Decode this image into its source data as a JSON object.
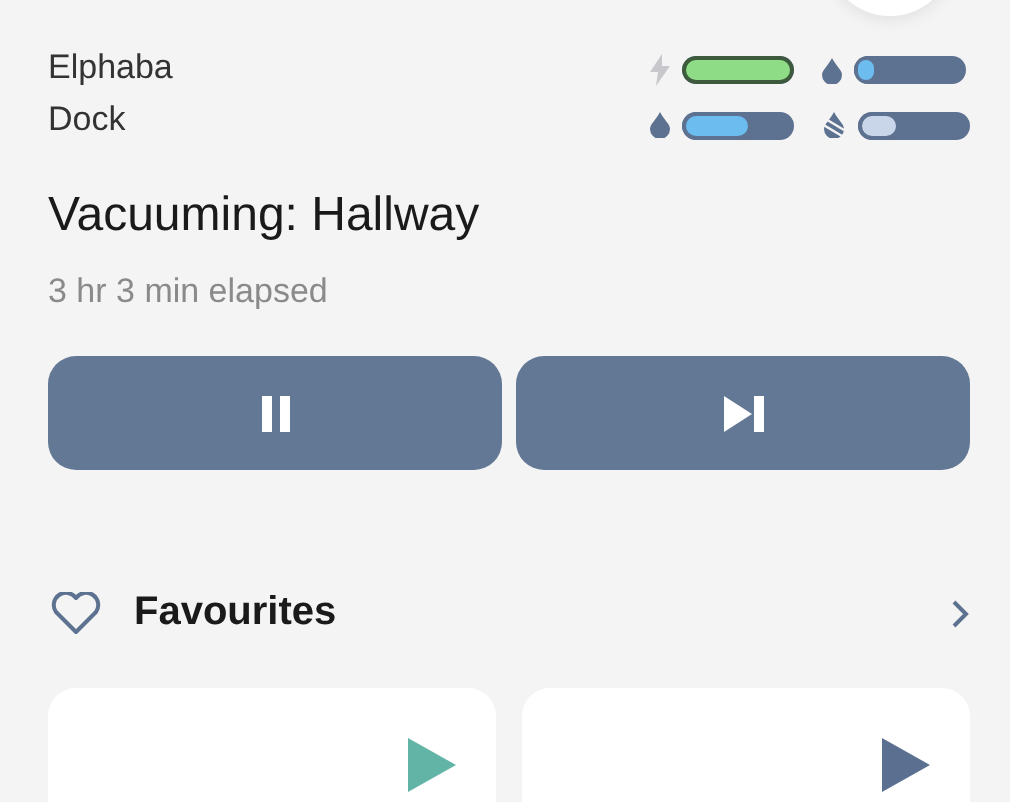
{
  "device": {
    "name": "Elphaba",
    "location": "Dock"
  },
  "meters": [
    {
      "kind": "battery",
      "level": 1,
      "color": "#8fdc86"
    },
    {
      "kind": "water",
      "level": 0.12,
      "color": "#6cbcf0"
    },
    {
      "kind": "water",
      "level": 0.62,
      "color": "#6cbcf0"
    },
    {
      "kind": "dirty",
      "level": 0.38,
      "color": "#c9d5e8"
    }
  ],
  "status": {
    "title": "Vacuuming: Hallway",
    "elapsed": "3 hr 3 min elapsed"
  },
  "controls": [
    {
      "kind": "pause"
    },
    {
      "kind": "skip"
    }
  ],
  "favourites": {
    "title": "Favourites",
    "cards": [
      {
        "color": "#62b5a6"
      },
      {
        "color": "#5b7091"
      }
    ]
  }
}
